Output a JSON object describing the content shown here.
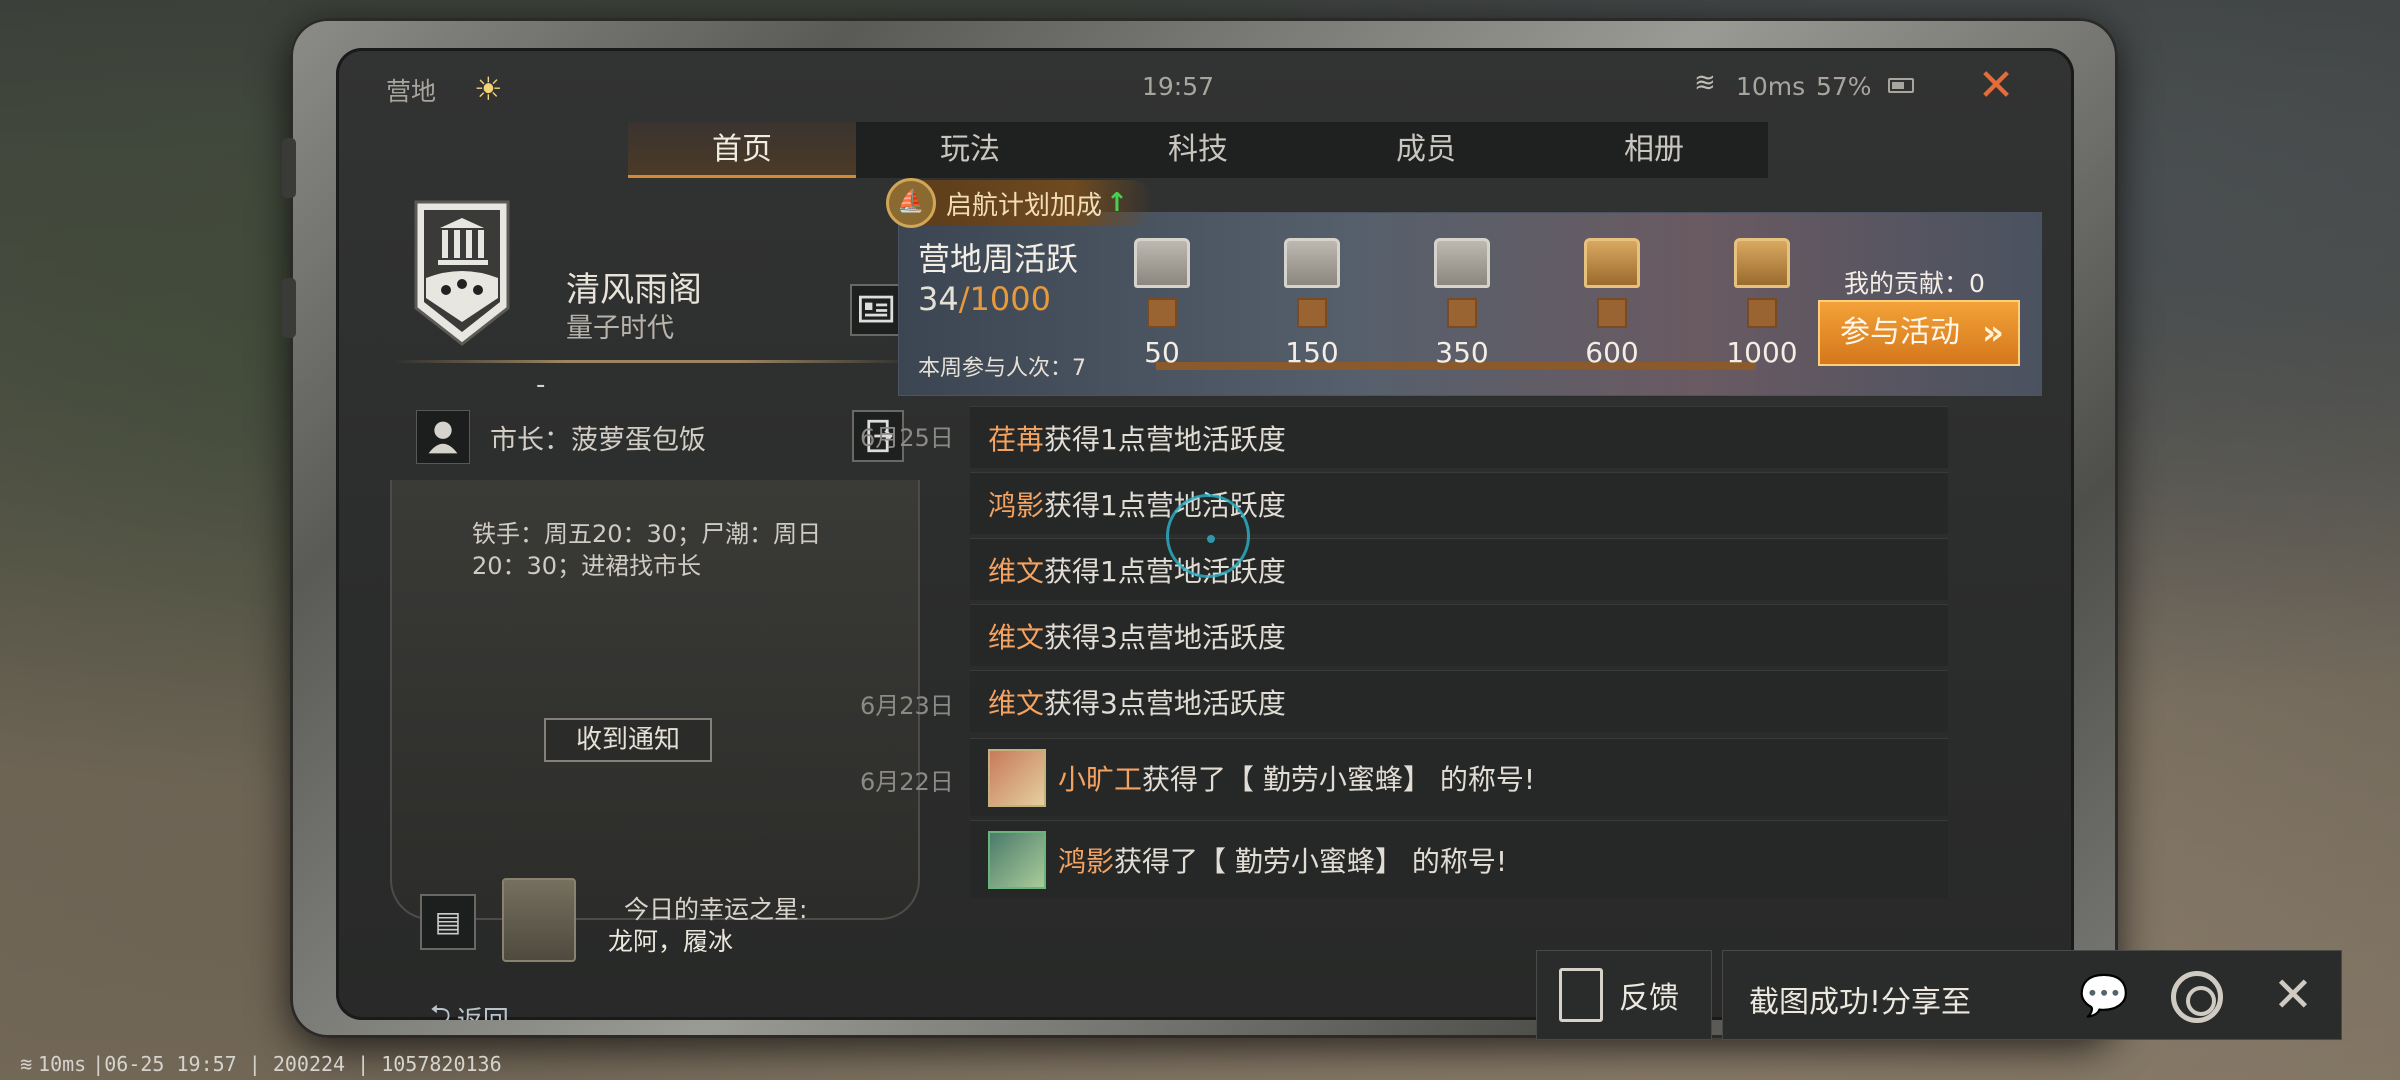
{
  "status": {
    "place": "营地",
    "time": "19:57",
    "ping": "10ms",
    "battery": "57%"
  },
  "tabs": [
    {
      "label": "首页",
      "active": true
    },
    {
      "label": "玩法"
    },
    {
      "label": "科技"
    },
    {
      "label": "成员"
    },
    {
      "label": "相册"
    }
  ],
  "camp": {
    "name": "清风雨阁",
    "subtitle": "量子时代",
    "dash": "-",
    "mayor": "市长：菠萝蛋包饭",
    "notice": "铁手：周五20：30；尸潮：周日20：30；进裙找市长",
    "notify_button": "收到通知",
    "lucky_title": "今日的幸运之星:",
    "lucky_names": "龙阿，履冰",
    "back_label": "返回"
  },
  "activity": {
    "boost_label": "启航计划加成",
    "title": "营地周活跃",
    "current": "34",
    "max": "/1000",
    "participants": "本周参与人次：7",
    "milestones": [
      "50",
      "150",
      "350",
      "600",
      "1000"
    ],
    "contribution": "我的贡献：0",
    "join_button": "参与活动"
  },
  "feed": [
    {
      "date": "6月25日",
      "who": "荏苒",
      "text": "获得1点营地活跃度"
    },
    {
      "date": "",
      "who": "鸿影",
      "text": "获得1点营地活跃度"
    },
    {
      "date": "",
      "who": "维文",
      "text": "获得1点营地活跃度"
    },
    {
      "date": "",
      "who": "维文",
      "text": "获得3点营地活跃度"
    },
    {
      "date": "6月23日",
      "who": "维文",
      "text": "获得3点营地活跃度"
    },
    {
      "date": "6月22日",
      "who": "小旷工",
      "text": "获得了【 勤劳小蜜蜂】 的称号!"
    },
    {
      "date": "",
      "who": "鸿影",
      "text": "获得了【 勤劳小蜜蜂】 的称号!"
    }
  ],
  "share": {
    "feedback_label": "反馈",
    "share_label": "截图成功!分享至"
  },
  "footer": {
    "ping": "10ms",
    "info": "|06-25 19:57 | 200224 | 1057820136"
  },
  "colors": {
    "accent": "#d5771c",
    "name_highlight": "#f3a260",
    "boost_arrow": "#47d04e",
    "close": "#e46b3a"
  }
}
